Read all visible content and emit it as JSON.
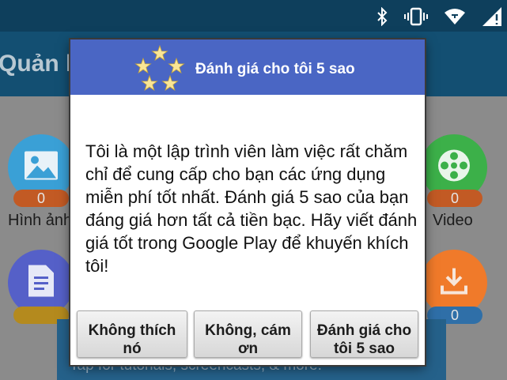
{
  "status_bar": {
    "icons": [
      "bluetooth-icon",
      "vibrate-icon",
      "wifi-icon",
      "battery-icon"
    ]
  },
  "app_bar": {
    "title": "Quản lý"
  },
  "tiles": [
    {
      "name": "images",
      "icon": "image-icon",
      "color": "#3aa0d6",
      "count": "0",
      "label": "Hình ảnh"
    },
    {
      "name": "video",
      "icon": "film-icon",
      "color": "#3cb049",
      "count": "0",
      "label": "Video"
    },
    {
      "name": "documents",
      "icon": "document-icon",
      "color": "#5560c8",
      "count": ""
    },
    {
      "name": "downloads",
      "icon": "download-icon",
      "color": "#f07a2a",
      "count": "0"
    }
  ],
  "snackbar": {
    "text": "Tap for tutorials, screencasts, & more."
  },
  "dialog": {
    "title": "Đánh giá cho tôi 5 sao",
    "header_icon": "five-stars-icon",
    "header_color": "#4a66c4",
    "body": "Tôi là một lập trình viên làm việc rất chăm chỉ để cung cấp cho bạn các ứng dụng miễn phí tốt nhất. Đánh giá 5 sao của bạn đáng giá hơn tất cả tiền bạc. Hãy viết đánh giá tốt trong Google Play để khuyến khích tôi!",
    "buttons": {
      "dislike": "Không thích nó",
      "no_thanks": "Không, cám ơn",
      "rate": "Đánh giá cho tôi 5 sao"
    }
  }
}
